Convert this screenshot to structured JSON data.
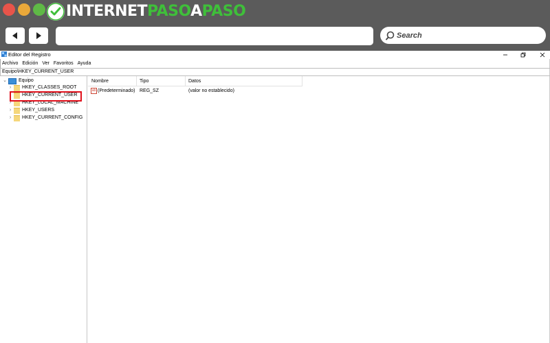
{
  "browser": {
    "logo": {
      "part1": "INTERNET",
      "part2": "PASO",
      "part3": "A",
      "part4": "PASO"
    },
    "address_value": "",
    "search_placeholder": "Search",
    "colors": {
      "chrome": "#5b5b5b",
      "brand_green": "#3fbf3a",
      "close_dot": "#e8544a",
      "min_dot": "#e9a83a",
      "max_dot": "#5fb946"
    }
  },
  "window": {
    "title": "Editor del Registro",
    "controls": {
      "minimize": "–",
      "maximize": "❐",
      "close": "✕"
    }
  },
  "menu": [
    "Archivo",
    "Edición",
    "Ver",
    "Favoritos",
    "Ayuda"
  ],
  "path": "Equipo\\HKEY_CURRENT_USER",
  "tree": {
    "root": "Equipo",
    "keys": [
      "HKEY_CLASSES_ROOT",
      "HKEY_CURRENT_USER",
      "HKEY_LOCAL_MACHINE",
      "HKEY_USERS",
      "HKEY_CURRENT_CONFIG"
    ],
    "selected_index": 1,
    "highlight_color": "#e0101b"
  },
  "list": {
    "columns": [
      "Nombre",
      "Tipo",
      "Datos"
    ],
    "rows": [
      {
        "name": "(Predeterminado)",
        "type": "REG_SZ",
        "data": "(valor no establecido)"
      }
    ]
  }
}
